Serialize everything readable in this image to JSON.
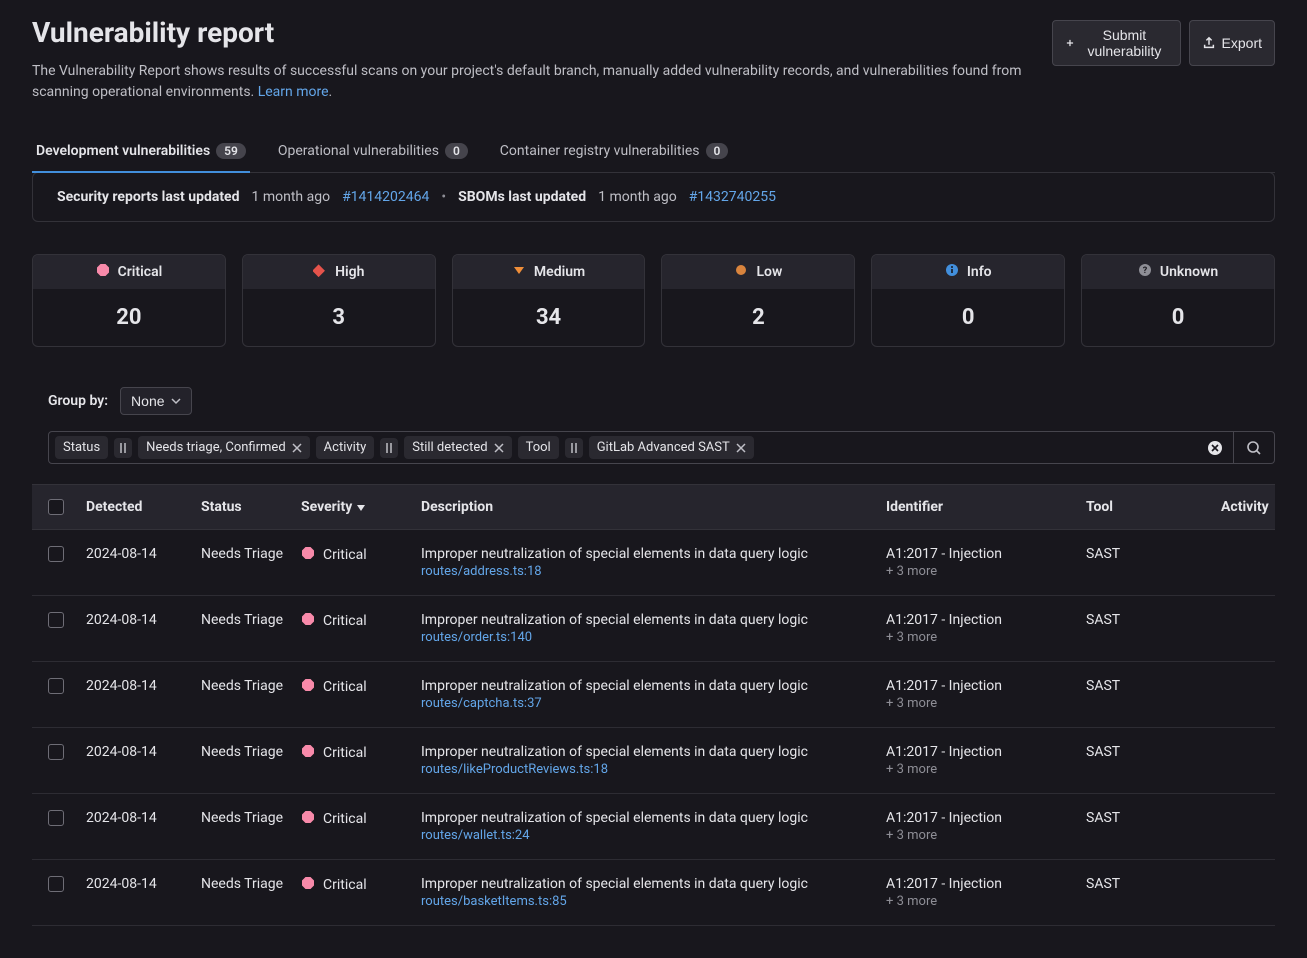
{
  "header": {
    "title": "Vulnerability report",
    "desc_pre": "The Vulnerability Report shows results of successful scans on your project's default branch, manually added vulnerability records, and vulnerabilities found from scanning operational environments. ",
    "learn_more": "Learn more",
    "desc_post": ".",
    "submit": "Submit vulnerability",
    "export": "Export"
  },
  "tabs": [
    {
      "label": "Development vulnerabilities",
      "count": "59",
      "active": true
    },
    {
      "label": "Operational vulnerabilities",
      "count": "0",
      "active": false
    },
    {
      "label": "Container registry vulnerabilities",
      "count": "0",
      "active": false
    }
  ],
  "banner": {
    "sec_label": "Security reports last updated",
    "sec_time": "1 month ago",
    "sec_link": "#1414202464",
    "sbom_label": "SBOMs last updated",
    "sbom_time": "1 month ago",
    "sbom_link": "#1432740255"
  },
  "severities": [
    {
      "name": "Critical",
      "count": "20",
      "color": "#f88aaa"
    },
    {
      "name": "High",
      "count": "3",
      "color": "#e5534b"
    },
    {
      "name": "Medium",
      "count": "34",
      "color": "#ef8e39"
    },
    {
      "name": "Low",
      "count": "2",
      "color": "#d9843d"
    },
    {
      "name": "Info",
      "count": "0",
      "color": "#428fdc"
    },
    {
      "name": "Unknown",
      "count": "0",
      "color": "#8e8e96"
    }
  ],
  "group_by": {
    "label": "Group by:",
    "value": "None"
  },
  "filters": {
    "status_label": "Status",
    "status_value": "Needs triage, Confirmed",
    "activity_label": "Activity",
    "activity_value": "Still detected",
    "tool_label": "Tool",
    "tool_value": "GitLab Advanced SAST"
  },
  "columns": {
    "detected": "Detected",
    "status": "Status",
    "severity": "Severity",
    "description": "Description",
    "identifier": "Identifier",
    "tool": "Tool",
    "activity": "Activity"
  },
  "rows": [
    {
      "detected": "2024-08-14",
      "status": "Needs Triage",
      "severity": "Critical",
      "desc": "Improper neutralization of special elements in data query logic",
      "path": "routes/address.ts:18",
      "ident": "A1:2017 - Injection",
      "more": "+ 3 more",
      "tool": "SAST"
    },
    {
      "detected": "2024-08-14",
      "status": "Needs Triage",
      "severity": "Critical",
      "desc": "Improper neutralization of special elements in data query logic",
      "path": "routes/order.ts:140",
      "ident": "A1:2017 - Injection",
      "more": "+ 3 more",
      "tool": "SAST"
    },
    {
      "detected": "2024-08-14",
      "status": "Needs Triage",
      "severity": "Critical",
      "desc": "Improper neutralization of special elements in data query logic",
      "path": "routes/captcha.ts:37",
      "ident": "A1:2017 - Injection",
      "more": "+ 3 more",
      "tool": "SAST"
    },
    {
      "detected": "2024-08-14",
      "status": "Needs Triage",
      "severity": "Critical",
      "desc": "Improper neutralization of special elements in data query logic",
      "path": "routes/likeProductReviews.ts:18",
      "ident": "A1:2017 - Injection",
      "more": "+ 3 more",
      "tool": "SAST"
    },
    {
      "detected": "2024-08-14",
      "status": "Needs Triage",
      "severity": "Critical",
      "desc": "Improper neutralization of special elements in data query logic",
      "path": "routes/wallet.ts:24",
      "ident": "A1:2017 - Injection",
      "more": "+ 3 more",
      "tool": "SAST"
    },
    {
      "detected": "2024-08-14",
      "status": "Needs Triage",
      "severity": "Critical",
      "desc": "Improper neutralization of special elements in data query logic",
      "path": "routes/basketItems.ts:85",
      "ident": "A1:2017 - Injection",
      "more": "+ 3 more",
      "tool": "SAST"
    }
  ]
}
